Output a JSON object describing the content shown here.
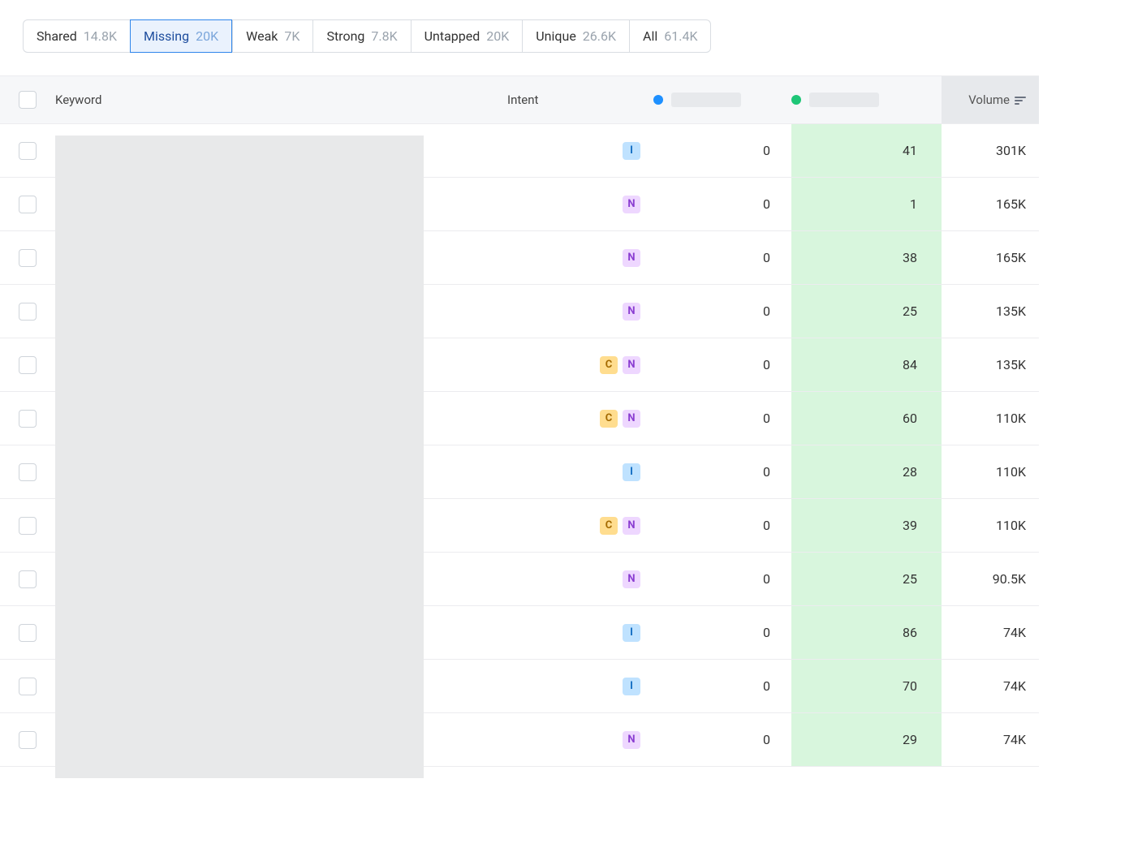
{
  "tabs": [
    {
      "label": "Shared",
      "count": "14.8K",
      "active": false
    },
    {
      "label": "Missing",
      "count": "20K",
      "active": true
    },
    {
      "label": "Weak",
      "count": "7K",
      "active": false
    },
    {
      "label": "Strong",
      "count": "7.8K",
      "active": false
    },
    {
      "label": "Untapped",
      "count": "20K",
      "active": false
    },
    {
      "label": "Unique",
      "count": "26.6K",
      "active": false
    },
    {
      "label": "All",
      "count": "61.4K",
      "active": false
    }
  ],
  "columns": {
    "keyword": "Keyword",
    "intent": "Intent",
    "volume": "Volume"
  },
  "dot_colors": {
    "site_a": "#1e90ff",
    "site_b": "#1ec677"
  },
  "intent_legend": {
    "I": "Informational",
    "N": "Navigational",
    "C": "Commercial"
  },
  "rows": [
    {
      "intent": [
        "I"
      ],
      "a": "0",
      "b": "41",
      "volume": "301K"
    },
    {
      "intent": [
        "N"
      ],
      "a": "0",
      "b": "1",
      "volume": "165K"
    },
    {
      "intent": [
        "N"
      ],
      "a": "0",
      "b": "38",
      "volume": "165K"
    },
    {
      "intent": [
        "N"
      ],
      "a": "0",
      "b": "25",
      "volume": "135K"
    },
    {
      "intent": [
        "C",
        "N"
      ],
      "a": "0",
      "b": "84",
      "volume": "135K"
    },
    {
      "intent": [
        "C",
        "N"
      ],
      "a": "0",
      "b": "60",
      "volume": "110K"
    },
    {
      "intent": [
        "I"
      ],
      "a": "0",
      "b": "28",
      "volume": "110K"
    },
    {
      "intent": [
        "C",
        "N"
      ],
      "a": "0",
      "b": "39",
      "volume": "110K"
    },
    {
      "intent": [
        "N"
      ],
      "a": "0",
      "b": "25",
      "volume": "90.5K"
    },
    {
      "intent": [
        "I"
      ],
      "a": "0",
      "b": "86",
      "volume": "74K"
    },
    {
      "intent": [
        "I"
      ],
      "a": "0",
      "b": "70",
      "volume": "74K"
    },
    {
      "intent": [
        "N"
      ],
      "a": "0",
      "b": "29",
      "volume": "74K"
    }
  ]
}
